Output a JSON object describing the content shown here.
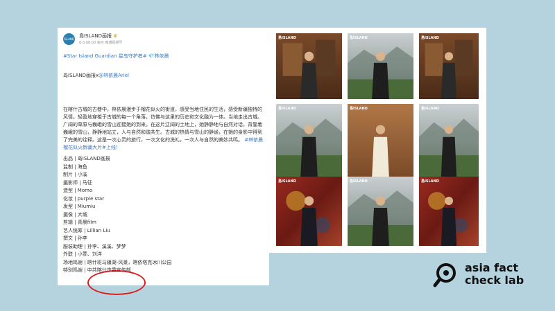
{
  "post": {
    "account_name": "島ISLAND画报",
    "avatar_text": "ISLAND",
    "meta": "6-3 08:00 来自 微博视频号",
    "hashtags": "#Star Island Guardian 星岛守护者# 💎林依晨",
    "collab_prefix": "岛ISLAND画报x",
    "collab_mention": "@林依晨Ariel",
    "paragraph": "在喀什古城的古巷中，林依晨漫步于榴花似火的街道，感受当地住民的生活，感受新疆独特的风情。轻盈地穿梭于古城的每一个角落，仿佛与这里的历史和文化融为一体。当地走出古城。广阔的草原与巍峨的雪山迎接她的到来。在这片辽阔的土地上，她静静地与自然对话，背靠着巍峨的雪山，静静地站立，人与自然和谐共生。古城的热情与雪山的静谧，在她的身影中得到了完美的诠释。这是一次心灵的旅行，一次文化的洗礼，一次人与自然的美妙共鸣。",
    "topic_tag": "#林依晨榴花似火新疆大片#上线！",
    "credits": [
      "出品 | 岛ISLAND画报",
      "监制 | 海鱼",
      "制片 | 小溪",
      "摄影师 | 马征",
      "造型 | Momo",
      "化妆 | purple star",
      "发型 | Miumiu",
      "摄像 | 大城",
      "剪辑 | 青晨film",
      "艺人统筹 | Lillian Liu",
      "撰文 | 孙李",
      "服装助理 | 孙李、溪溪、梦梦",
      "外联 | 小萱、刘洋",
      "场地鸣谢 | 喀什班马疆湖-风景，喀依塔克冰川公园",
      "特别鸣谢 | 中共喀什市委宣传部"
    ]
  },
  "photos": {
    "watermark": "島ISLAND"
  },
  "logo": {
    "line1": "asia fact",
    "line2": "check lab"
  },
  "colors": {
    "background": "#b5d3de",
    "link": "#3a78c0",
    "highlight_circle": "#d81e1e"
  }
}
